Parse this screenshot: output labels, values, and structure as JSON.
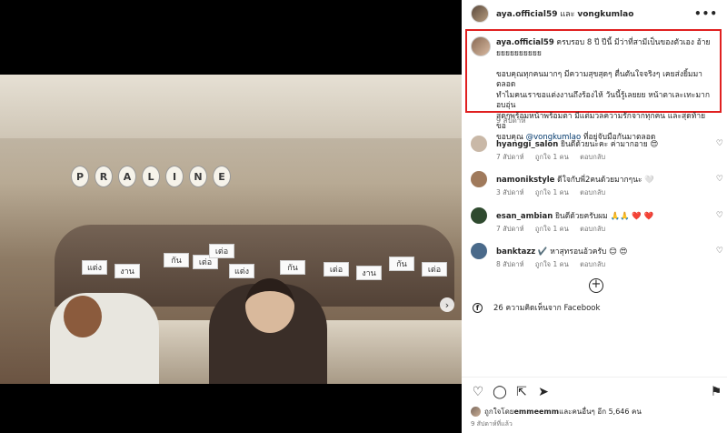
{
  "header": {
    "author": "aya.official59",
    "joiner": " และ ",
    "collaborator": "vongkumlao",
    "more_label": "•••"
  },
  "caption": {
    "username": "aya.official59",
    "line1": " ครบรอบ 8 ปี ปีนี้ มีว่าที่สามีเป็นของตัวเอง อ้าย",
    "line2": "ยยยยยยยยยย",
    "line3": "ขอบคุณทุกคนมากๆ มีความสุขสุดๆ ตื่นตันใจจริงๆ เคยส่งยิ้มมาตลอด",
    "line4": "ทำไมคนเราขอแต่งงานถึงร้องไห้ วันนี้รู้เลยยย หน้าตาเละเทะมาก อบอุ่น",
    "line5": "สุดๆพร้อมหน้าพร้อมตา มีแต่มวลความรักจากทุกคน และสุดท้ายขอ",
    "line6_prefix": "ขอบคุณ ",
    "mention": "@vongkumlao",
    "line6_suffix": " ที่อยู่จับมือกันมาตลอด",
    "time": "9 สัปดาห์"
  },
  "comments": [
    {
      "username": "hyanggi_salon",
      "text": " ยินดีด้วยนะคะ ค่ามากอาย 😍",
      "time": "7 สัปดาห์",
      "likes": "ถูกใจ 1 คน",
      "reply": "ตอบกลับ",
      "avatar_color": "#c9b8a7"
    },
    {
      "username": "namonikstyle",
      "text": " ดีใจกับพี่2คนด้วยมากๆนะ 🤍",
      "time": "3 สัปดาห์",
      "likes": "ถูกใจ 1 คน",
      "reply": "ตอบกลับ",
      "avatar_color": "#a07a5c"
    },
    {
      "username": "esan_ambian",
      "text": " ยินดีด้วยครับผม 🙏🙏 ❤️ ❤️",
      "time": "7 สัปดาห์",
      "likes": "ถูกใจ 1 คน",
      "reply": "ตอบกลับ",
      "avatar_color": "#2f4a2f"
    },
    {
      "username": "banktazz",
      "text": " ✔️ หาสุทรอนอ้วครับ 😊 😍",
      "time": "8 สัปดาห์",
      "likes": "ถูกใจ 1 คน",
      "reply": "ตอบกลับ",
      "avatar_color": "#4a6a8a"
    }
  ],
  "add_more_label": "+",
  "facebook": {
    "icon": "f",
    "text": "26 ความคิดเห็นจาก Facebook"
  },
  "actions": {
    "like_icon": "♡",
    "comment_icon": "◯",
    "share_icon": "⇱",
    "send_icon": "➤",
    "save_icon": "⚑"
  },
  "likes": {
    "prefix": "ถูกใจโดย ",
    "user": "emmeemm",
    "suffix": " และคนอื่นๆ อีก 5,646 คน"
  },
  "post_time": "9 สัปดาห์ที่แล้ว",
  "photo": {
    "sign_letters": [
      "P",
      "R",
      "A",
      "L",
      "I",
      "N",
      "E"
    ],
    "cards": [
      "แต่ง",
      "งาน",
      "กัน",
      "เต่อ",
      "แต่ง",
      "กัน",
      "เต่อ",
      "งาน",
      "กัน",
      "เต่อ",
      "เต่อ"
    ],
    "next_icon": "›",
    "tag_icon": "●"
  },
  "colors": {
    "highlight_border": "#e02020",
    "mention": "#00376b",
    "meta_gray": "#737373"
  }
}
